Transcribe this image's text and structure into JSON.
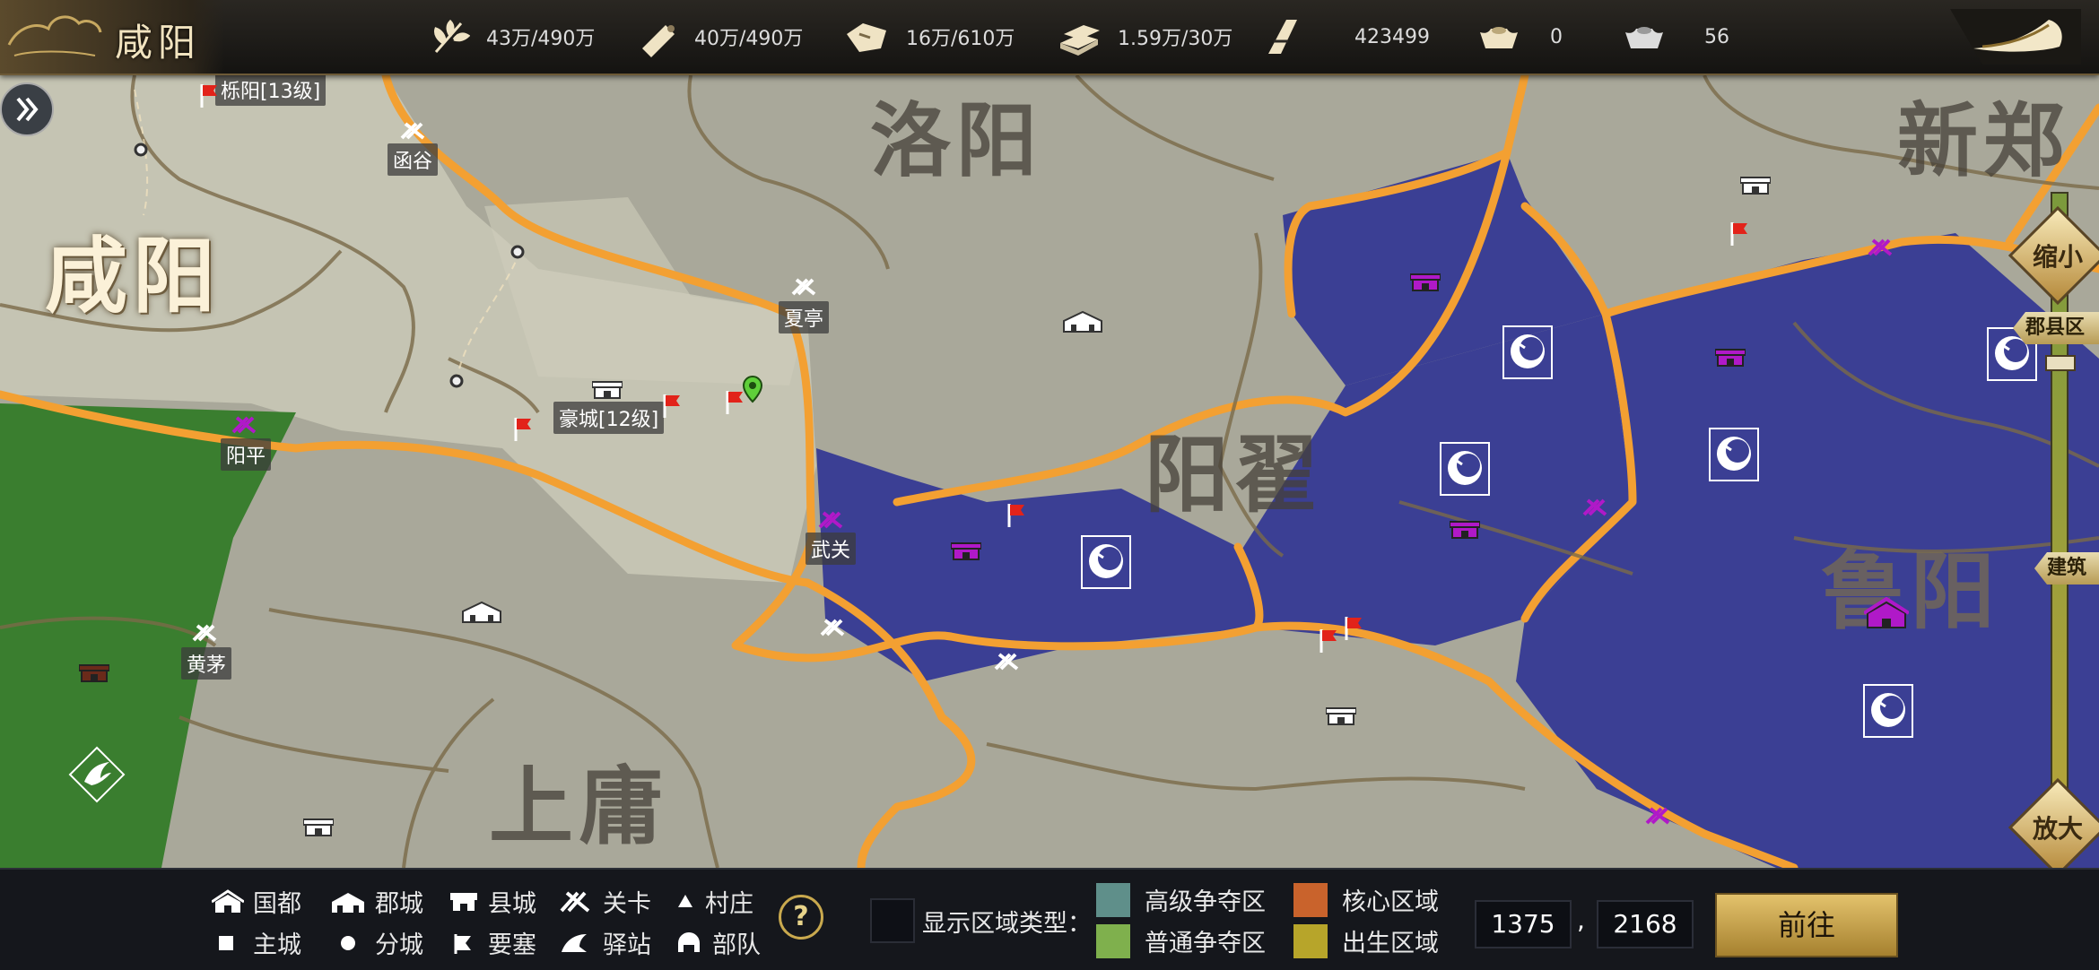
{
  "header": {
    "city": "咸阳",
    "resources": [
      {
        "icon": "grain-icon",
        "value": "43万/490万"
      },
      {
        "icon": "wood-icon",
        "value": "40万/490万"
      },
      {
        "icon": "stone-icon",
        "value": "16万/610万"
      },
      {
        "icon": "iron-icon",
        "value": "1.59万/30万"
      },
      {
        "icon": "token-icon",
        "value": "423499"
      },
      {
        "icon": "gold-ingot-icon",
        "value": "0"
      },
      {
        "icon": "silver-ingot-icon",
        "value": "56"
      }
    ]
  },
  "map": {
    "regions": [
      "咸阳",
      "洛阳",
      "新郑",
      "阳翟",
      "鲁阳",
      "上庸"
    ],
    "cities": [
      "栎阳[13级]",
      "函谷",
      "夏亭",
      "豪城[12级]",
      "阳平",
      "武关",
      "黄茅"
    ]
  },
  "zoom": {
    "shrink": "缩小",
    "enlarge": "放大",
    "county": "郡县区域",
    "building": "建筑"
  },
  "legend": {
    "items": [
      "国都",
      "郡城",
      "县城",
      "关卡",
      "村庄",
      "主城",
      "分城",
      "要塞",
      "驿站",
      "部队"
    ],
    "display_label": "显示区域类型：",
    "zones": [
      {
        "label": "高级争夺区",
        "color": "#5f8f8a"
      },
      {
        "label": "核心区域",
        "color": "#c9632c"
      },
      {
        "label": "普通争夺区",
        "color": "#7fb04d"
      },
      {
        "label": "出生区域",
        "color": "#b7a52a"
      }
    ]
  },
  "coords": {
    "x": "1375",
    "sep": ",",
    "y": "2168"
  },
  "go_button": "前往",
  "help_button": "?"
}
